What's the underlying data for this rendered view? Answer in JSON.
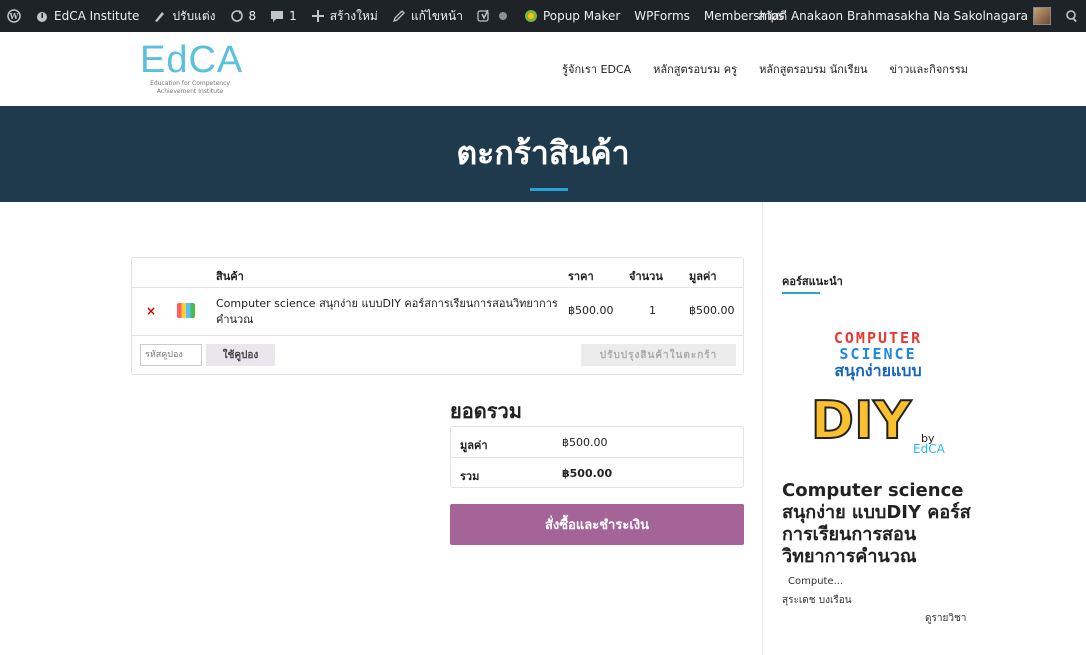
{
  "admin_bar": {
    "site_name": "EdCA Institute",
    "customize": "ปรับแต่ง",
    "updates_count": "8",
    "comments_count": "1",
    "new": "สร้างใหม่",
    "edit_page": "แก้ไขหน้า",
    "popup_maker": "Popup Maker",
    "wpforms": "WPForms",
    "memberships": "Memberships",
    "greeting": "สวัสดี Anakaon Brahmasakha Na Sakolnagara"
  },
  "logo": {
    "main": "EdCA",
    "sub_line1": "Education for Competency",
    "sub_line2": "Achievement Institute"
  },
  "nav": {
    "items": [
      {
        "label": "รู้จักเรา EDCA"
      },
      {
        "label": "หลักสูตรอบรม ครู"
      },
      {
        "label": "หลักสูตรอบรม นักเรียน"
      },
      {
        "label": "ข่าวและกิจกรรม"
      }
    ]
  },
  "hero": {
    "title": "ตะกร้าสินค้า"
  },
  "cart": {
    "headers": {
      "product": "สินค้า",
      "price": "ราคา",
      "quantity": "จำนวน",
      "subtotal": "มูลค่า"
    },
    "items": [
      {
        "remove": "×",
        "name": "Computer science สนุกง่าย แบบDIY คอร์สการเรียนการสอนวิทยาการคำนวณ",
        "price": "฿500.00",
        "quantity": "1",
        "subtotal": "฿500.00"
      }
    ],
    "coupon_placeholder": "รหัสคูปอง",
    "apply_coupon": "ใช้คูปอง",
    "update_cart": "ปรับปรุงสินค้าในตะกร้า"
  },
  "totals": {
    "title": "ยอดรวม",
    "subtotal_label": "มูลค่า",
    "subtotal_value": "฿500.00",
    "total_label": "รวม",
    "total_value": "฿500.00",
    "checkout": "สั่งซื้อและชำระเงิน"
  },
  "sidebar": {
    "title": "คอร์สแนะนำ",
    "image_text": {
      "line1": "COMPUTER",
      "line2": "SCIENCE",
      "line3": "สนุกง่ายแบบ",
      "diy": "DIY",
      "by": "by",
      "brand": "EdCA"
    },
    "course_title": "Computer science สนุกง่าย แบบDIY คอร์สการเรียนการสอนวิทยาการคำนวณ",
    "excerpt": "Compute...",
    "author": "สุระเดช บงเรือน",
    "more": "ดูรายวิชา"
  },
  "colors": {
    "admin_bar": "#1d2327",
    "hero_bg": "#1f3a4d",
    "accent_line": "#2aa3d4",
    "checkout_bg": "#a46497",
    "remove": "#d40000",
    "logo": "#5bc0de"
  }
}
